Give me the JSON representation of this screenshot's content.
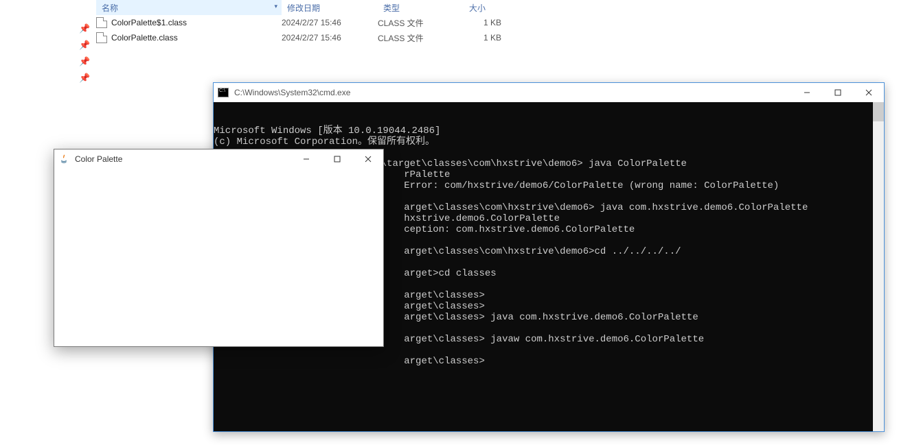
{
  "explorer": {
    "columns": {
      "name": "名称",
      "date": "修改日期",
      "type": "类型",
      "size": "大小"
    },
    "files": [
      {
        "name": "ColorPalette$1.class",
        "date": "2024/2/27 15:46",
        "type": "CLASS 文件",
        "size": "1 KB"
      },
      {
        "name": "ColorPalette.class",
        "date": "2024/2/27 15:46",
        "type": "CLASS 文件",
        "size": "1 KB"
      }
    ]
  },
  "cmd": {
    "title": "C:\\Windows\\System32\\cmd.exe",
    "lines": [
      "Microsoft Windows [版本 10.0.19044.2486]",
      "(c) Microsoft Corporation。保留所有权利。",
      "",
      "E:\\~work_demo\\demo_java_tools\\target\\classes\\com\\hxstrive\\demo6> java ColorPalette",
      "                                 rPalette",
      "                                 Error: com/hxstrive/demo6/ColorPalette (wrong name: ColorPalette)",
      "",
      "                                 arget\\classes\\com\\hxstrive\\demo6> java com.hxstrive.demo6.ColorPalette",
      "                                 hxstrive.demo6.ColorPalette",
      "                                 ception: com.hxstrive.demo6.ColorPalette",
      "",
      "                                 arget\\classes\\com\\hxstrive\\demo6>cd ../../../../",
      "",
      "                                 arget>cd classes",
      "",
      "                                 arget\\classes>",
      "                                 arget\\classes>",
      "                                 arget\\classes> java com.hxstrive.demo6.ColorPalette",
      "",
      "                                 arget\\classes> javaw com.hxstrive.demo6.ColorPalette",
      "",
      "                                 arget\\classes>"
    ]
  },
  "java": {
    "title": "Color Palette"
  }
}
